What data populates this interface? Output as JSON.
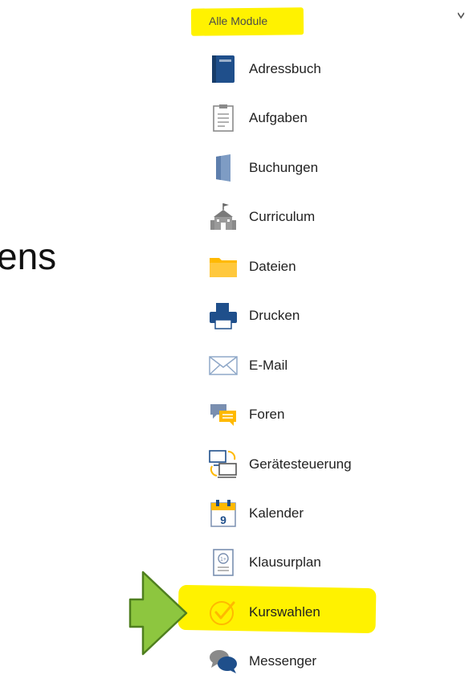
{
  "background_text": "ens",
  "panel": {
    "title": "Alle Module"
  },
  "modules": [
    {
      "label": "Adressbuch",
      "icon": "address-book-icon"
    },
    {
      "label": "Aufgaben",
      "icon": "clipboard-icon"
    },
    {
      "label": "Buchungen",
      "icon": "booking-door-icon"
    },
    {
      "label": "Curriculum",
      "icon": "school-building-icon"
    },
    {
      "label": "Dateien",
      "icon": "folder-icon"
    },
    {
      "label": "Drucken",
      "icon": "printer-icon"
    },
    {
      "label": "E-Mail",
      "icon": "envelope-icon"
    },
    {
      "label": "Foren",
      "icon": "forum-chat-icon"
    },
    {
      "label": "Gerätesteuerung",
      "icon": "device-control-icon"
    },
    {
      "label": "Kalender",
      "icon": "calendar-icon"
    },
    {
      "label": "Klausurplan",
      "icon": "exam-plan-icon"
    },
    {
      "label": "Kurswahlen",
      "icon": "checkmark-circle-icon"
    },
    {
      "label": "Messenger",
      "icon": "messenger-bubbles-icon"
    }
  ],
  "colors": {
    "highlight": "#fff200",
    "arrow_fill": "#8dc63f",
    "arrow_stroke": "#4f7f1f",
    "icon_blue": "#1f4f8b",
    "folder_yellow": "#ffb900"
  }
}
